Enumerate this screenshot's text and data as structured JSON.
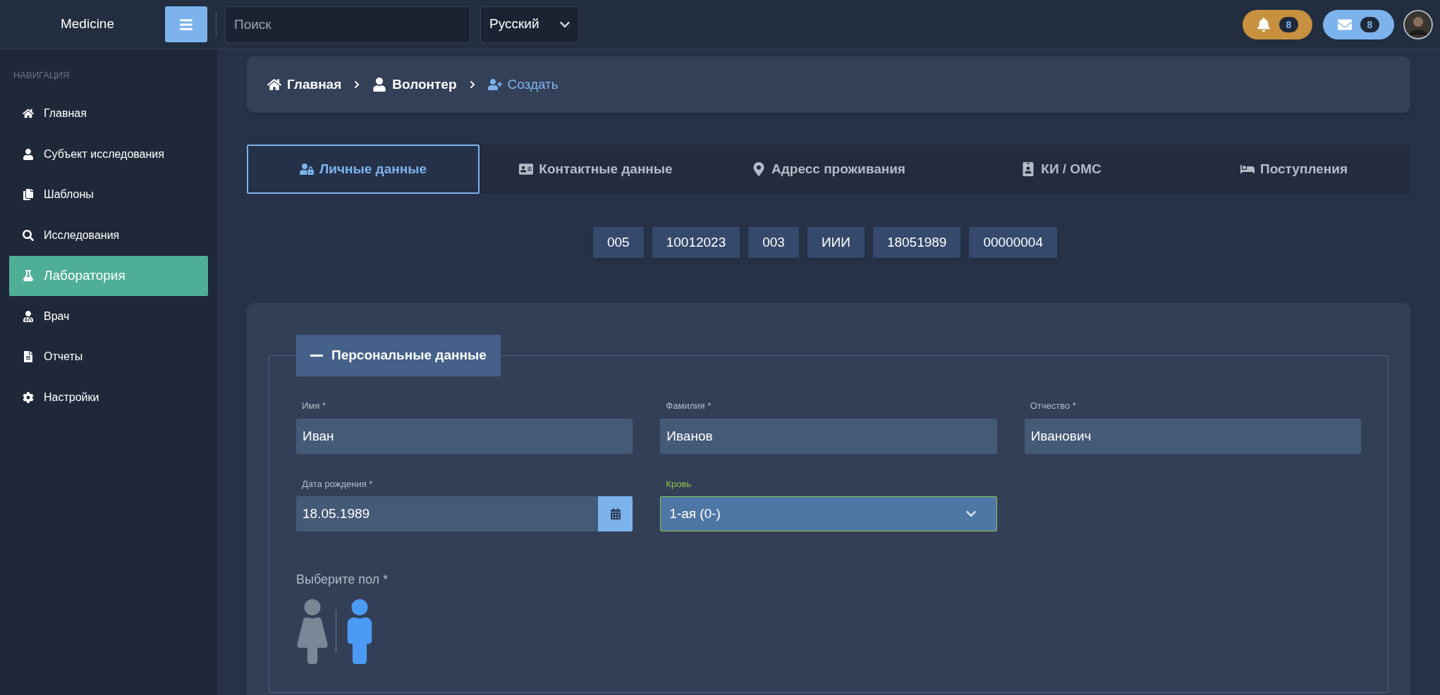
{
  "top_bar": {
    "logo": "Medicine",
    "search": {
      "placeholder": "Поиск"
    },
    "language": "Русский",
    "notifications": {
      "count": "8"
    },
    "messages": {
      "count": "8"
    }
  },
  "sidebar": {
    "heading": "НАВИГАЦИЯ",
    "items": [
      {
        "label": "Главная",
        "selected": false
      },
      {
        "label": "Субъект исследования",
        "selected": false
      },
      {
        "label": "Шаблоны",
        "selected": false
      },
      {
        "label": "Исследования",
        "selected": false
      },
      {
        "label": "Лаборатория",
        "selected": true
      },
      {
        "label": "Врач",
        "selected": false
      },
      {
        "label": "Отчеты",
        "selected": false
      },
      {
        "label": "Настройки",
        "selected": false
      }
    ]
  },
  "breadcrumb": [
    {
      "label": "Главная",
      "current": false
    },
    {
      "label": "Волонтер",
      "current": false
    },
    {
      "label": "Создать",
      "current": true
    }
  ],
  "tabs": [
    {
      "label": "Личные данные",
      "selected": true
    },
    {
      "label": "Контактные данные",
      "selected": false
    },
    {
      "label": "Адресс проживания",
      "selected": false
    },
    {
      "label": "КИ / ОМС",
      "selected": false
    },
    {
      "label": "Поступления",
      "selected": false
    }
  ],
  "codes": [
    "005",
    "10012023",
    "003",
    "ИИИ",
    "18051989",
    "00000004"
  ],
  "section": {
    "legend": "Персональные данные",
    "fields": [
      {
        "kind": "text",
        "label": "Имя *",
        "value": "Иван",
        "focused": false
      },
      {
        "kind": "text",
        "label": "Фамилия *",
        "value": "Иванов",
        "focused": false
      },
      {
        "kind": "text",
        "label": "Отчество *",
        "value": "Иванович",
        "focused": false
      },
      {
        "kind": "date",
        "label": "Дата рождения *",
        "value": "18.05.1989",
        "focused": false
      },
      {
        "kind": "select",
        "label": "Кровь",
        "value": "1-ая (0-)",
        "focused": true
      }
    ],
    "gender": {
      "label": "Выберите пол *",
      "options": [
        {
          "kind": "female",
          "selected": false
        },
        {
          "kind": "male",
          "selected": true
        }
      ]
    }
  }
}
